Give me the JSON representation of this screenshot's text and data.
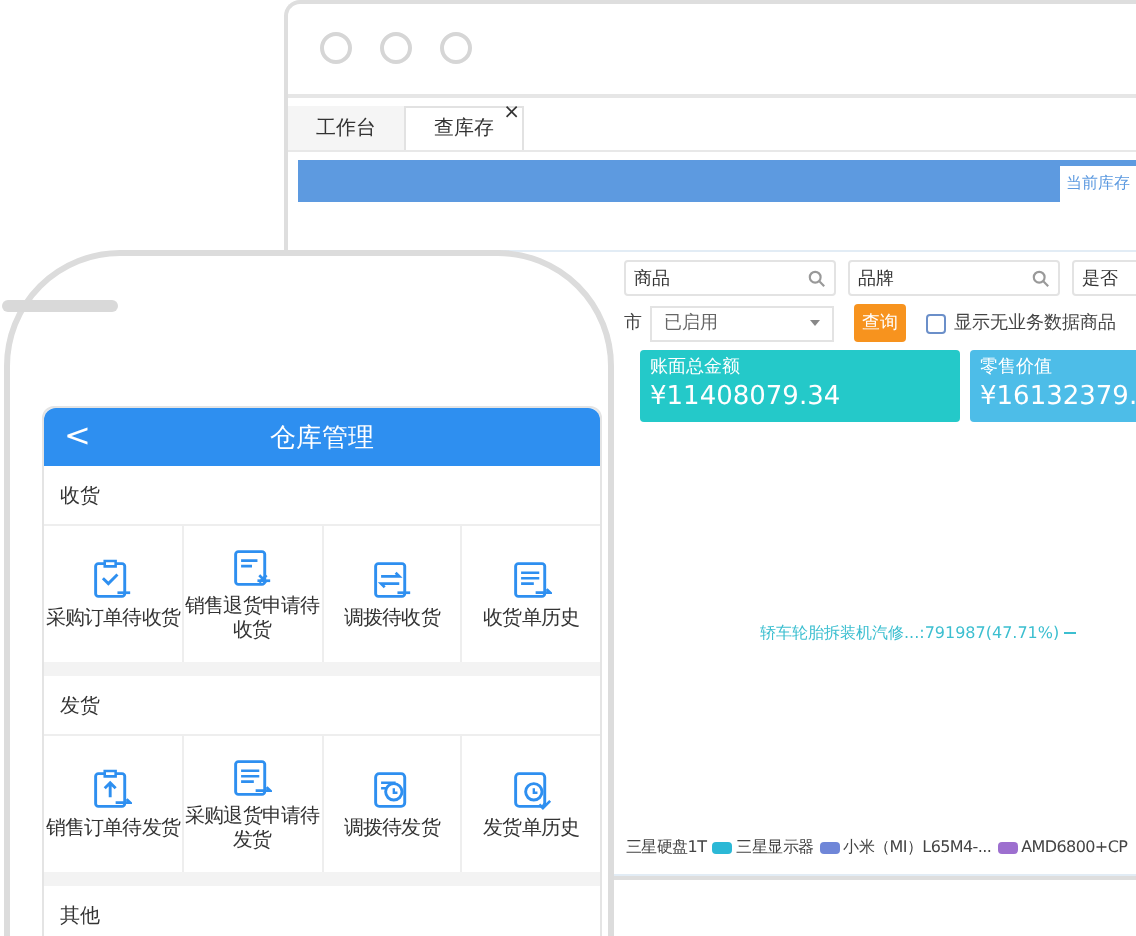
{
  "desktop": {
    "tabs": [
      {
        "label": "工作台",
        "selected": false,
        "closable": false
      },
      {
        "label": "查库存",
        "selected": true,
        "closable": true
      }
    ],
    "close_mark": "×",
    "subtab": "当前库存",
    "filters": [
      {
        "value": "商品"
      },
      {
        "value": "品牌"
      },
      {
        "value": "是否"
      }
    ],
    "status": {
      "label": "市",
      "value": "已启用"
    },
    "query_button": "查询",
    "checkbox": {
      "label": "显示无业务数据商品",
      "checked": false
    },
    "cards": [
      {
        "title": "账面总金额",
        "value": "¥11408079.34",
        "color": "#24c9c9"
      },
      {
        "title": "零售价值",
        "value": "¥16132379.",
        "color": "#4dbde8"
      }
    ],
    "chart_label": "轿车轮胎拆装机汽修...:791987(47.71%)",
    "legend": [
      {
        "label": "三星硬盘1T"
      },
      {
        "label": "三星显示器",
        "color": "#2bb8d6"
      },
      {
        "label": "小米（MI）L65M4-...",
        "color": "#6f86d8"
      },
      {
        "label": "AMD6800+CP",
        "color": "#9d6fcf"
      }
    ]
  },
  "phone": {
    "title": "仓库管理",
    "back": "<",
    "sections": [
      {
        "title": "收货",
        "items": [
          {
            "label": "采购订单待收货"
          },
          {
            "label": "销售退货申请待收货"
          },
          {
            "label": "调拨待收货"
          },
          {
            "label": "收货单历史"
          }
        ]
      },
      {
        "title": "发货",
        "items": [
          {
            "label": "销售订单待发货"
          },
          {
            "label": "采购退货申请待发货"
          },
          {
            "label": "调拨待发货"
          },
          {
            "label": "发货单历史"
          }
        ]
      },
      {
        "title": "其他"
      }
    ]
  }
}
